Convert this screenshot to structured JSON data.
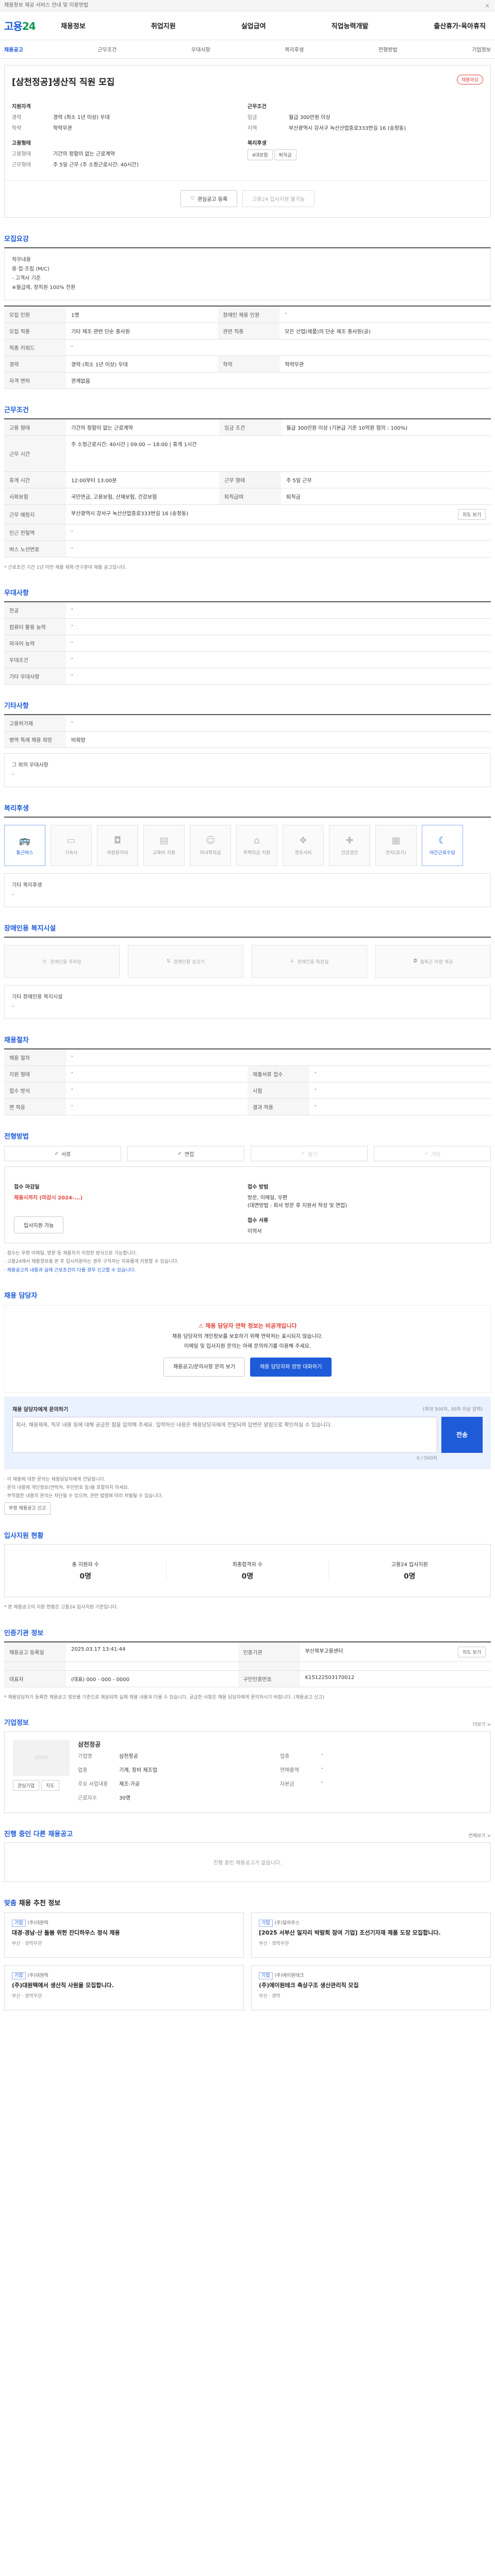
{
  "notice": {
    "text": "채용정보 제공 서비스 안내 및 이용방법",
    "close": "×"
  },
  "header": {
    "logo_main": "고용",
    "logo_num": "24",
    "gnb": [
      "채용정보",
      "취업지원",
      "실업급여",
      "직업능력개발",
      "출산휴가·육아휴직"
    ]
  },
  "subnav": [
    "채용공고",
    "근무조건",
    "우대사항",
    "복리후생",
    "전형방법",
    "기업정보"
  ],
  "job": {
    "title": "[삼천정공]생산직 직원 모집",
    "badge": "채용마감",
    "left_heading1": "지원자격",
    "left": [
      {
        "k": "경력",
        "v": "경력 (최소 1년 이상) 우대"
      },
      {
        "k": "학력",
        "v": "학력무관"
      }
    ],
    "left_heading2": "고용형태",
    "left2": [
      {
        "k": "고용형태",
        "v": "기간의 정함이 없는 근로계약"
      },
      {
        "k": "근무형태",
        "v": "주 5일 근무 (주 소정근로시간: 40시간)"
      }
    ],
    "right_heading1": "근무조건",
    "right": [
      {
        "k": "임금",
        "v": "월급 300만원 이상"
      },
      {
        "k": "지역",
        "v": "부산광역시 강서구 녹산산업중로333번길 16 (송정동)"
      }
    ],
    "right_heading2": "복리후생",
    "right_tags": [
      "4대보험",
      "퇴직금"
    ],
    "btn_interest": "관심공고 등록",
    "btn_apply": "고용24 입사지원 불가능"
  },
  "recruit": {
    "heading": "모집요강",
    "desc": [
      "직무내용",
      "용·접·조립 (M/C)",
      "- 고객사 기준",
      "※월급제, 정직원 100% 전환"
    ],
    "rows": [
      {
        "k": "모집 인원",
        "v": "1명",
        "k2": "장애인 채용 인원",
        "v2": "-"
      },
      {
        "k": "모집 직종",
        "v": "기타 제조 관련 단순 종사원",
        "k2": "관련 직종",
        "v2": "모든 산업(제품)의 단순 제조 종사원(공)"
      },
      {
        "k": "직종 키워드",
        "v": "-",
        "k2": "",
        "v2": ""
      },
      {
        "k": "경력",
        "v": "경력 (최소 1년 이상) 우대",
        "k2": "학력",
        "v2": "학력무관"
      },
      {
        "k": "자격 면허",
        "v": "관계없음",
        "k2": "",
        "v2": ""
      }
    ]
  },
  "conditions": {
    "heading": "근무조건",
    "rows": [
      {
        "k": "고용 형태",
        "v": "기간의 정함이 없는 근로계약",
        "k2": "임금 조건",
        "v2": "월급 300만원 이상 (기본급 기준 10억원 협의 : 100%)"
      },
      {
        "k": "근무 시간",
        "v": "주 소정근로시간: 40시간  |  09:00 ~ 18:00  |  휴게 1시간",
        "k2": "",
        "v2": ""
      },
      {
        "k": "휴게 시간",
        "v": "12:00부터 13:00분",
        "k2": "근무 형태",
        "v2": "주 5일 근무"
      },
      {
        "k": "사회보험",
        "v": "국민연금, 고용보험, 산재보험, 건강보험",
        "k2": "퇴직급여",
        "v2": "퇴직금"
      },
      {
        "k": "근무 예정지",
        "v": "부산광역시 강서구 녹산산업중로333번길 16 (송정동)",
        "k2": "",
        "v2": ""
      },
      {
        "k": "인근 전철역",
        "v": "-",
        "k2": "",
        "v2": ""
      },
      {
        "k": "버스 노선번호",
        "v": "-",
        "k2": "",
        "v2": ""
      }
    ],
    "map_btn": "지도 보기",
    "note": "* 근로조건 기간 1년 미만 채용 제목·연구분야 채용 공고입니다."
  },
  "preference": {
    "heading": "우대사항",
    "rows": [
      {
        "k": "전공",
        "v": "-"
      },
      {
        "k": "컴퓨터 활용 능력",
        "v": "-"
      },
      {
        "k": "외국어 능력",
        "v": "-"
      },
      {
        "k": "우대조건",
        "v": "-"
      },
      {
        "k": "기타 우대사항",
        "v": "-"
      }
    ]
  },
  "other": {
    "heading": "기타사항",
    "rows": [
      {
        "k": "고용허가제",
        "v": "-"
      },
      {
        "k": "병역 특례 채용 희망",
        "v": "비희망"
      }
    ],
    "extra_k": "그 외의 우대사항",
    "extra_v": "-"
  },
  "welfare": {
    "heading": "복리후생",
    "items": [
      {
        "label": "통근버스",
        "on": true
      },
      {
        "label": "기숙사",
        "on": false
      },
      {
        "label": "차량유지비",
        "on": false
      },
      {
        "label": "교육비 지원",
        "on": false
      },
      {
        "label": "자녀학자금",
        "on": false
      },
      {
        "label": "주택자금 지원",
        "on": false
      },
      {
        "label": "경조사비",
        "on": false
      },
      {
        "label": "건강검진",
        "on": false
      },
      {
        "label": "연차(휴가)",
        "on": false
      },
      {
        "label": "야간근로수당",
        "on": true
      }
    ],
    "etc_k": "기타 복리후생",
    "etc_v": "-"
  },
  "disabled": {
    "heading": "장애인용 복지시설",
    "items": [
      "장애인용 주차장",
      "장애인용 승강기",
      "장애인용 화장실",
      "출퇴근 차량 제공"
    ],
    "etc_k": "기타 장애인용 복지시설",
    "etc_v": "-"
  },
  "process": {
    "heading": "채용절차",
    "rows": [
      {
        "k": "채용 절차",
        "v": "-",
        "k2": "",
        "v2": ""
      },
      {
        "k": "지원 형태",
        "v": "-",
        "k2": "제출서류 접수",
        "v2": "-"
      },
      {
        "k": "접수 방식",
        "v": "-",
        "k2": "시험",
        "v2": "-"
      },
      {
        "k": "면 적응",
        "v": "-",
        "k2": "결과 적용",
        "v2": "-"
      }
    ]
  },
  "selection": {
    "heading": "전형방법",
    "methods": [
      {
        "label": "서류",
        "dis": false
      },
      {
        "label": "면접",
        "dis": false
      },
      {
        "label": "필기",
        "dis": true
      },
      {
        "label": "기타",
        "dis": true
      }
    ],
    "deadline_k": "접수 마감일",
    "deadline_v": "채용시까지 (마감시 2024-...)",
    "method_k": "접수 방법",
    "method_v": "방문, 이메일, 우편",
    "method_v2": "(대면방법 : 회사 방문 후 지원서 작성 및 면접)",
    "resume_k": "접수 서류",
    "resume_v": "이력서",
    "apply_btn": "입사지원 가능",
    "notes": [
      "· 접수는 우편 이메일, 방문 등 채용자가 지정한 방식으로 가능합니다.",
      "· 고용24에서 채용정보를 본 후 입사지원하는 경우 구직자는 자유롭게 지원할 수 있습니다.",
      "· 채용공고의 내용과 실제 근로조건이 다를 경우 신고할 수 있습니다."
    ]
  },
  "contact": {
    "heading": "채용 담당자",
    "alert_t": "채용 담당자 연락 정보는 비공개입니다",
    "alert_lines": [
      "채용 담당자의 개인정보를 보호하기 위해 연락처는 표시되지 않습니다.",
      "이메일 및 입사지원 문의는 아래 문의하기를 이용해 주세요."
    ],
    "btn1": "채용공고/문의사항 문의 보기",
    "btn2": "채용 담당자와 양방 대화하기",
    "inq_title": "채용 담당자에게 문의하기",
    "inq_hint": "(최대 500자, 30자 이상 입력)",
    "inq_placeholder": "회사, 채용제목, 직무 내용 등에 대해 궁금한 점을 입력해 주세요. 입력하신 내용은 채용담당자에게 전달되며 답변은 알림으로 확인하실 수 있습니다.",
    "inq_count": "0 / 500자",
    "inq_send": "전송",
    "inq_notes": [
      "· 이 채용에 대한 문의는 채용담당자에게 전달됩니다.",
      "· 문의 내용에 개인정보(연락처, 주민번호 등)를 포함하지 마세요.",
      "· 부적절한 내용의 문의는 차단될 수 있으며, 관련 법령에 따라 처벌될 수 있습니다."
    ],
    "report_btn": "부정 채용공고 신고"
  },
  "applicants": {
    "heading": "입사지원 현황",
    "items": [
      {
        "label": "총 지원자 수",
        "n": "0명"
      },
      {
        "label": "최종합격자 수",
        "n": "0명"
      },
      {
        "label": "고용24 입사지원",
        "n": "0명"
      }
    ],
    "note": "* 본 채용공고의 지원 현황은 고용24 입사지원 기준입니다."
  },
  "registration": {
    "heading": "인증기관 정보",
    "rows": [
      {
        "k": "채용공고 등록일",
        "v": "2025.03.17 13:41:44",
        "k2": "인증기관",
        "v2": "부산북부고용센터"
      },
      {
        "k": "",
        "v": "",
        "k2": "",
        "v2": ""
      },
      {
        "k": "대표자",
        "v": "(대표) 000 - 000 - 0000",
        "k2": "구인인증번호",
        "v2": "K15122503170012"
      }
    ],
    "find_btn": "지도 보기",
    "notes": "* 채용담당자가 등록한 채용공고 정보를 기준으로 제공되며 실제 채용 내용과 다를 수 있습니다. 궁금한 사항은 채용 담당자에게 문의하시기 바랍니다. (채용공고 신고)"
  },
  "company": {
    "heading": "기업정보",
    "more": "더보기 >",
    "logo": "LOGO",
    "name": "삼천정공",
    "fields": [
      {
        "k": "기업명",
        "v": "삼천정공",
        "k2": "업종",
        "v2": "-"
      },
      {
        "k": "업종",
        "v": "기계, 장비 제조업",
        "k2": "연매출액",
        "v2": "-"
      },
      {
        "k": "주요 사업내용",
        "v": "제조·가공",
        "k2": "자본금",
        "v2": "-"
      },
      {
        "k": "근로자수",
        "v": "30명",
        "k2": "",
        "v2": ""
      }
    ],
    "btn_a": "관심기업",
    "btn_b": "지도"
  },
  "ongoing": {
    "heading": "진행 중인 다른 채용공고",
    "more": "전체보기 >",
    "empty": "진행 중인 채용공고가 없습니다."
  },
  "recommend": {
    "heading": "맞춤",
    "heading_rest": "채용 추천 정보",
    "cards": [
      {
        "tag": "기업",
        "cn": "(주)대원텍",
        "title": "대경·경남·산 돌봄 위한 잔디하우스 정식 채용",
        "meta": "부산 · 경력무관"
      },
      {
        "tag": "기업",
        "cn": "(주)일하우스",
        "title": "[2025 서부산 일자리 박람회 참여 기업] 조선기자재 제품 도장 모집합니다.",
        "meta": "부산 · 경력무관"
      },
      {
        "tag": "기업",
        "cn": "(주)대원텍",
        "title": "(주)대원텍에서 생산직 사원을 모집합니다.",
        "meta": "부산 · 경력무관"
      },
      {
        "tag": "기업",
        "cn": "(주)에이원테크",
        "title": "(주)에이원테크 축상구조 생산관리직 모집",
        "meta": "부산 · 경력"
      }
    ]
  }
}
